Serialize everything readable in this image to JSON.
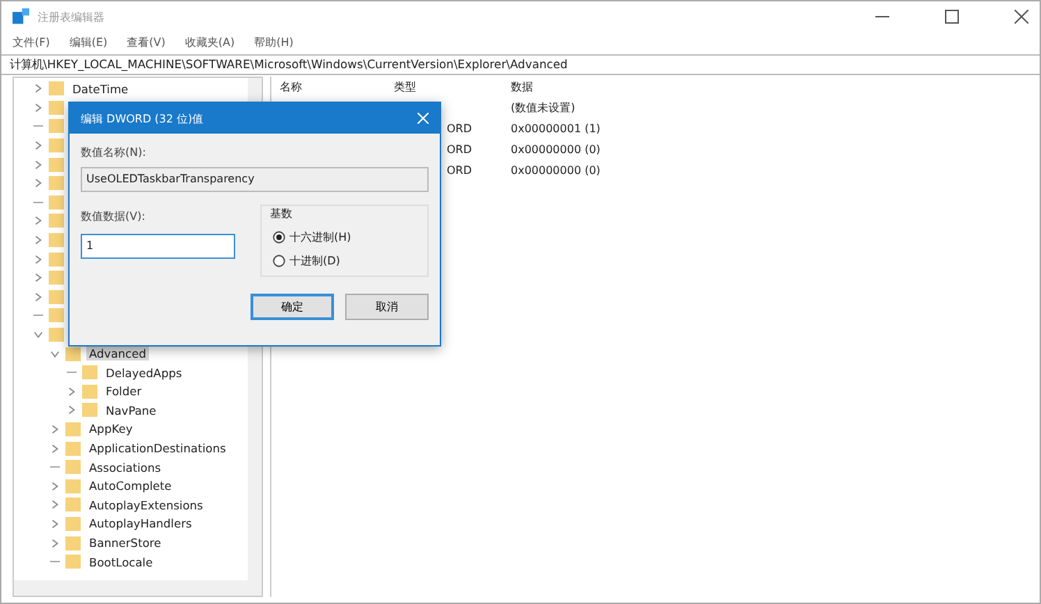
{
  "window": {
    "title": "注册表编辑器"
  },
  "menu": [
    "文件(F)",
    "编辑(E)",
    "查看(V)",
    "收藏夹(A)",
    "帮助(H)"
  ],
  "address": "计算机\\HKEY_LOCAL_MACHINE\\SOFTWARE\\Microsoft\\Windows\\CurrentVersion\\Explorer\\Advanced",
  "tree": [
    {
      "name": "DateTime",
      "kind": "branch",
      "expanded": false,
      "selected": false
    },
    {
      "kind": "branch",
      "expanded": false,
      "selected": false
    },
    {
      "kind": "leaf",
      "selected": false
    },
    {
      "kind": "branch",
      "expanded": false,
      "selected": false
    },
    {
      "kind": "branch",
      "expanded": false,
      "selected": false
    },
    {
      "kind": "branch",
      "expanded": false,
      "selected": false
    },
    {
      "kind": "leaf",
      "selected": false
    },
    {
      "kind": "branch",
      "expanded": false,
      "selected": false
    },
    {
      "kind": "branch",
      "expanded": false,
      "selected": false
    },
    {
      "kind": "branch",
      "expanded": false,
      "selected": false
    },
    {
      "kind": "branch",
      "expanded": false,
      "selected": false
    },
    {
      "kind": "branch",
      "expanded": false,
      "selected": false
    },
    {
      "kind": "leaf",
      "selected": false
    },
    {
      "kind": "branch",
      "expanded": true,
      "selected": false,
      "children": [
        {
          "name": "Advanced",
          "kind": "branch",
          "expanded": true,
          "selected": true,
          "children": [
            {
              "name": "DelayedApps",
              "kind": "leaf",
              "selected": false
            },
            {
              "name": "Folder",
              "kind": "branch",
              "expanded": false,
              "selected": false
            },
            {
              "name": "NavPane",
              "kind": "branch",
              "expanded": false,
              "selected": false
            }
          ]
        },
        {
          "name": "AppKey",
          "kind": "branch",
          "expanded": false,
          "selected": false
        },
        {
          "name": "ApplicationDestinations",
          "kind": "branch",
          "expanded": false,
          "selected": false
        },
        {
          "name": "Associations",
          "kind": "leaf",
          "selected": false
        },
        {
          "name": "AutoComplete",
          "kind": "branch",
          "expanded": false,
          "selected": false
        },
        {
          "name": "AutoplayExtensions",
          "kind": "branch",
          "expanded": false,
          "selected": false
        },
        {
          "name": "AutoplayHandlers",
          "kind": "branch",
          "expanded": false,
          "selected": false
        },
        {
          "name": "BannerStore",
          "kind": "branch",
          "expanded": false,
          "selected": false
        },
        {
          "name": "BootLocale",
          "kind": "leaf",
          "selected": false
        }
      ]
    }
  ],
  "table": {
    "columns": [
      "名称",
      "类型",
      "数据"
    ],
    "rows": [
      {
        "type": "",
        "data": "(数值未设置)"
      },
      {
        "type": "ORD",
        "data": "0x00000001 (1)"
      },
      {
        "type": "ORD",
        "data": "0x00000000 (0)"
      },
      {
        "type": "ORD",
        "data": "0x00000000 (0)"
      }
    ]
  },
  "dialog": {
    "title": "编辑 DWORD (32 位)值",
    "name_label": "数值名称(N):",
    "name_value": "UseOLEDTaskbarTransparency",
    "data_label": "数值数据(V):",
    "data_value": "1",
    "base_label": "基数",
    "bases": [
      {
        "label": "十六进制(H)",
        "selected": true
      },
      {
        "label": "十进制(D)",
        "selected": false
      }
    ],
    "buttons": [
      "确定",
      "取消"
    ]
  }
}
